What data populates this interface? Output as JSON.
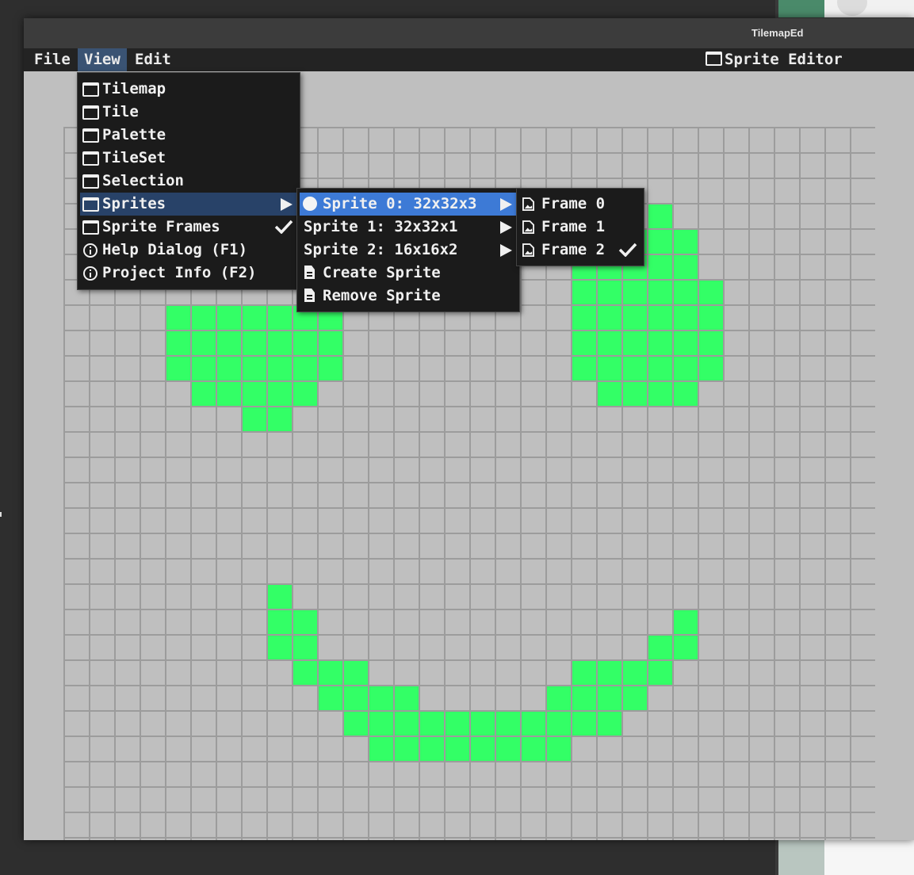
{
  "window": {
    "title": "TilemapEd"
  },
  "menubar": {
    "items": [
      {
        "label": "File"
      },
      {
        "label": "View"
      },
      {
        "label": "Edit"
      }
    ],
    "active": "View",
    "editor_label": "Sprite Editor"
  },
  "view_menu": {
    "items": [
      {
        "label": "Tilemap",
        "icon": "window-icon"
      },
      {
        "label": "Tile",
        "icon": "window-icon"
      },
      {
        "label": "Palette",
        "icon": "window-icon"
      },
      {
        "label": "TileSet",
        "icon": "window-icon"
      },
      {
        "label": "Selection",
        "icon": "window-icon"
      },
      {
        "label": "Sprites",
        "icon": "window-icon",
        "submenu": true,
        "highlighted": true
      },
      {
        "label": "Sprite Frames",
        "icon": "window-icon",
        "checked": true
      },
      {
        "label": "Help Dialog (F1)",
        "icon": "info-icon"
      },
      {
        "label": "Project Info (F2)",
        "icon": "info-icon"
      }
    ]
  },
  "sprites_menu": {
    "items": [
      {
        "label": "Sprite 0: 32x32x3",
        "icon": "circle-icon",
        "submenu": true,
        "selected": true
      },
      {
        "label": "Sprite 1: 32x32x1",
        "submenu": true
      },
      {
        "label": "Sprite 2: 16x16x2",
        "submenu": true
      },
      {
        "label": "Create Sprite",
        "icon": "document-icon"
      },
      {
        "label": "Remove Sprite",
        "icon": "document-icon"
      }
    ]
  },
  "frames_menu": {
    "items": [
      {
        "label": "Frame 0",
        "icon": "image-file-icon"
      },
      {
        "label": "Frame 1",
        "icon": "image-file-icon"
      },
      {
        "label": "Frame 2",
        "icon": "image-file-icon",
        "checked": true
      }
    ]
  },
  "canvas": {
    "grid_columns": 32,
    "pixel_color": "#33ff66",
    "background_color": "#bfbfbf",
    "grid_color": "#9c9c9c",
    "filled_cells": [
      [
        23,
        3
      ],
      [
        21,
        4
      ],
      [
        22,
        4
      ],
      [
        23,
        4
      ],
      [
        24,
        4
      ],
      [
        20,
        5
      ],
      [
        21,
        5
      ],
      [
        22,
        5
      ],
      [
        23,
        5
      ],
      [
        24,
        5
      ],
      [
        20,
        6
      ],
      [
        21,
        6
      ],
      [
        22,
        6
      ],
      [
        23,
        6
      ],
      [
        24,
        6
      ],
      [
        25,
        6
      ],
      [
        4,
        7
      ],
      [
        5,
        7
      ],
      [
        6,
        7
      ],
      [
        7,
        7
      ],
      [
        8,
        7
      ],
      [
        9,
        7
      ],
      [
        10,
        7
      ],
      [
        20,
        7
      ],
      [
        21,
        7
      ],
      [
        22,
        7
      ],
      [
        23,
        7
      ],
      [
        24,
        7
      ],
      [
        25,
        7
      ],
      [
        4,
        8
      ],
      [
        5,
        8
      ],
      [
        6,
        8
      ],
      [
        7,
        8
      ],
      [
        8,
        8
      ],
      [
        9,
        8
      ],
      [
        10,
        8
      ],
      [
        20,
        8
      ],
      [
        21,
        8
      ],
      [
        22,
        8
      ],
      [
        23,
        8
      ],
      [
        24,
        8
      ],
      [
        25,
        8
      ],
      [
        4,
        9
      ],
      [
        5,
        9
      ],
      [
        6,
        9
      ],
      [
        7,
        9
      ],
      [
        8,
        9
      ],
      [
        9,
        9
      ],
      [
        10,
        9
      ],
      [
        20,
        9
      ],
      [
        21,
        9
      ],
      [
        22,
        9
      ],
      [
        23,
        9
      ],
      [
        24,
        9
      ],
      [
        25,
        9
      ],
      [
        5,
        10
      ],
      [
        6,
        10
      ],
      [
        7,
        10
      ],
      [
        8,
        10
      ],
      [
        9,
        10
      ],
      [
        21,
        10
      ],
      [
        22,
        10
      ],
      [
        23,
        10
      ],
      [
        24,
        10
      ],
      [
        7,
        11
      ],
      [
        8,
        11
      ],
      [
        8,
        18
      ],
      [
        8,
        19
      ],
      [
        9,
        19
      ],
      [
        24,
        19
      ],
      [
        8,
        20
      ],
      [
        9,
        20
      ],
      [
        23,
        20
      ],
      [
        24,
        20
      ],
      [
        9,
        21
      ],
      [
        10,
        21
      ],
      [
        11,
        21
      ],
      [
        20,
        21
      ],
      [
        21,
        21
      ],
      [
        22,
        21
      ],
      [
        23,
        21
      ],
      [
        10,
        22
      ],
      [
        11,
        22
      ],
      [
        12,
        22
      ],
      [
        13,
        22
      ],
      [
        19,
        22
      ],
      [
        20,
        22
      ],
      [
        21,
        22
      ],
      [
        22,
        22
      ],
      [
        11,
        23
      ],
      [
        12,
        23
      ],
      [
        13,
        23
      ],
      [
        14,
        23
      ],
      [
        15,
        23
      ],
      [
        16,
        23
      ],
      [
        17,
        23
      ],
      [
        18,
        23
      ],
      [
        19,
        23
      ],
      [
        20,
        23
      ],
      [
        21,
        23
      ],
      [
        12,
        24
      ],
      [
        13,
        24
      ],
      [
        14,
        24
      ],
      [
        15,
        24
      ],
      [
        16,
        24
      ],
      [
        17,
        24
      ],
      [
        18,
        24
      ],
      [
        19,
        24
      ]
    ]
  }
}
